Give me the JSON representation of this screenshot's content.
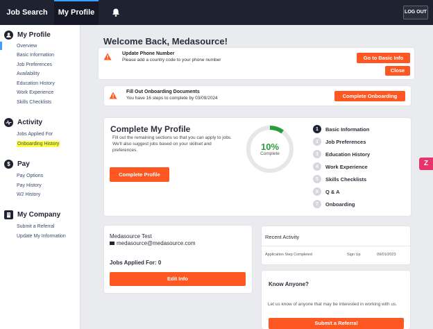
{
  "topnav": {
    "job_search": "Job Search",
    "my_profile": "My Profile",
    "logout": "LOG OUT"
  },
  "sidebar": {
    "my_profile": {
      "title": "My Profile",
      "items": [
        "Overview",
        "Basic Information",
        "Job Preferences",
        "Availability",
        "Education History",
        "Work Experience",
        "Skills Checklists"
      ]
    },
    "activity": {
      "title": "Activity",
      "items": [
        "Jobs Applied For",
        "Onboarding History"
      ]
    },
    "pay": {
      "title": "Pay",
      "items": [
        "Pay Options",
        "Pay History",
        "W2 History"
      ]
    },
    "company": {
      "title": "My Company",
      "items": [
        "Submit a Referral",
        "Update My Information"
      ]
    }
  },
  "welcome": "Welcome Back, Medasource!",
  "alerts": {
    "phone": {
      "title": "Update Phone Number",
      "text": "Please add a country code to your phone number",
      "button": "Go to Basic Info",
      "close": "Close"
    },
    "onboarding": {
      "title": "Fill Out Onboarding Documents",
      "text": "You have 16 steps to complete by 03/09/2024",
      "button": "Complete Onboarding"
    }
  },
  "complete_profile": {
    "title": "Complete My Profile",
    "desc": "Fill out the remaining sections so that you can apply to jobs. We'll also suggest jobs based on your skillset and preferences.",
    "button": "Complete Profile",
    "percent_label": "10%",
    "percent_value": 10,
    "ring_label": "Complete",
    "steps": [
      {
        "num": "1",
        "label": "Basic Information",
        "done": true
      },
      {
        "num": "2",
        "label": "Job Preferences",
        "done": false
      },
      {
        "num": "3",
        "label": "Education History",
        "done": false
      },
      {
        "num": "4",
        "label": "Work Experience",
        "done": false
      },
      {
        "num": "5",
        "label": "Skills Checklists",
        "done": false
      },
      {
        "num": "6",
        "label": "Q & A",
        "done": false
      },
      {
        "num": "7",
        "label": "Onboarding",
        "done": false
      }
    ]
  },
  "user_card": {
    "name": "Medasource Test",
    "email": "medasource@medasource.com",
    "jobs_applied": "Jobs Applied For: 0",
    "button": "Edit Info"
  },
  "recent_activity": {
    "title": "Recent Activity",
    "row": {
      "event": "Application Step Completed",
      "type": "Sign Up",
      "date": "09/01/2023"
    }
  },
  "know_anyone": {
    "title": "Know Anyone?",
    "text": "Let us know of anyone that may be interested in working with us.",
    "button": "Submit a Referral"
  },
  "colors": {
    "accent": "#ff5722",
    "nav": "#1f2231",
    "highlight": "#ffff3b",
    "progress": "#2a9d3a"
  }
}
